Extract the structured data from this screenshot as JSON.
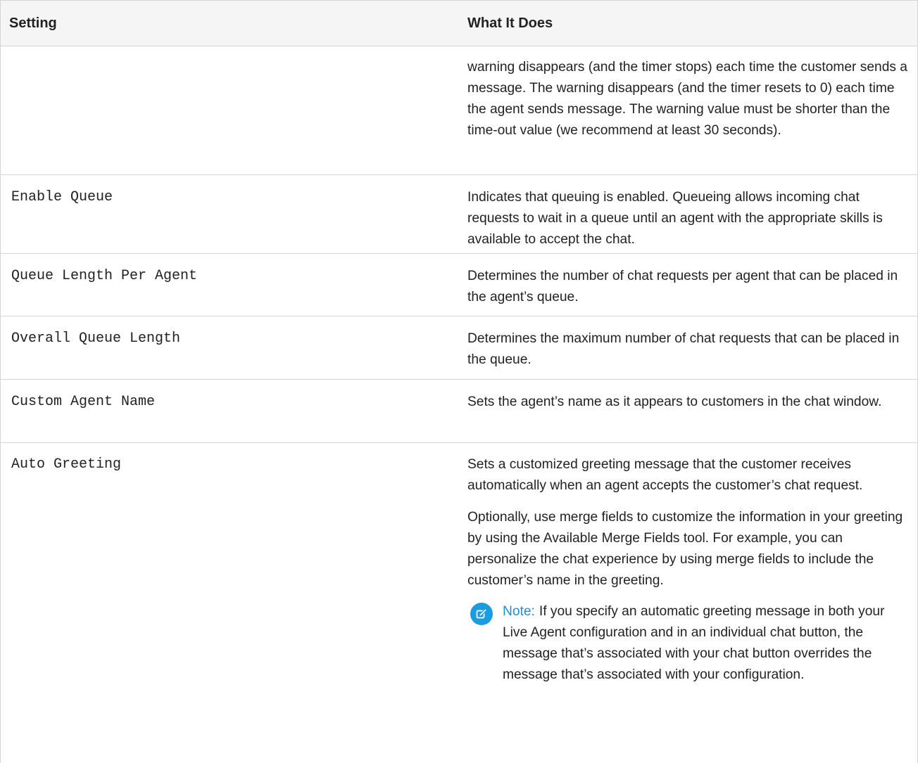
{
  "table": {
    "headers": {
      "setting": "Setting",
      "what_it_does": "What It Does"
    },
    "rows": [
      {
        "setting": "",
        "description": [
          "warning disappears (and the timer stops) each time the customer sends a message. The warning disappears (and the timer resets to 0) each time the agent sends message. The warning value must be shorter than the time-out value (we recommend at least 30 seconds)."
        ]
      },
      {
        "setting": "Enable Queue",
        "description": [
          "Indicates that queuing is enabled. Queueing allows incoming chat requests to wait in a queue until an agent with the appropriate skills is available to accept the chat."
        ]
      },
      {
        "setting": "Queue Length Per Agent",
        "description": [
          "Determines the number of chat requests per agent that can be placed in the agent’s queue."
        ]
      },
      {
        "setting": "Overall Queue Length",
        "description": [
          "Determines the maximum number of chat requests that can be placed in the queue."
        ]
      },
      {
        "setting": "Custom Agent Name",
        "description": [
          "Sets the agent’s name as it appears to customers in the chat window."
        ]
      },
      {
        "setting": "Auto Greeting",
        "description": [
          "Sets a customized greeting message that the customer receives automatically when an agent accepts the customer’s chat request.",
          "Optionally, use merge fields to customize the information in your greeting by using the Available Merge Fields tool. For example, you can personalize the chat experience by using merge fields to include the customer’s name in the greeting."
        ],
        "note": {
          "icon": "edit-note-icon",
          "label": "Note:",
          "text": "If you specify an automatic greeting message in both your Live Agent configuration and in an individual chat button, the message that’s associated with your chat button overrides the message that’s associated with your configuration."
        }
      }
    ]
  },
  "colors": {
    "note_accent": "#1b9be0",
    "header_bg": "#f5f5f5",
    "border": "#d4d4d4"
  }
}
